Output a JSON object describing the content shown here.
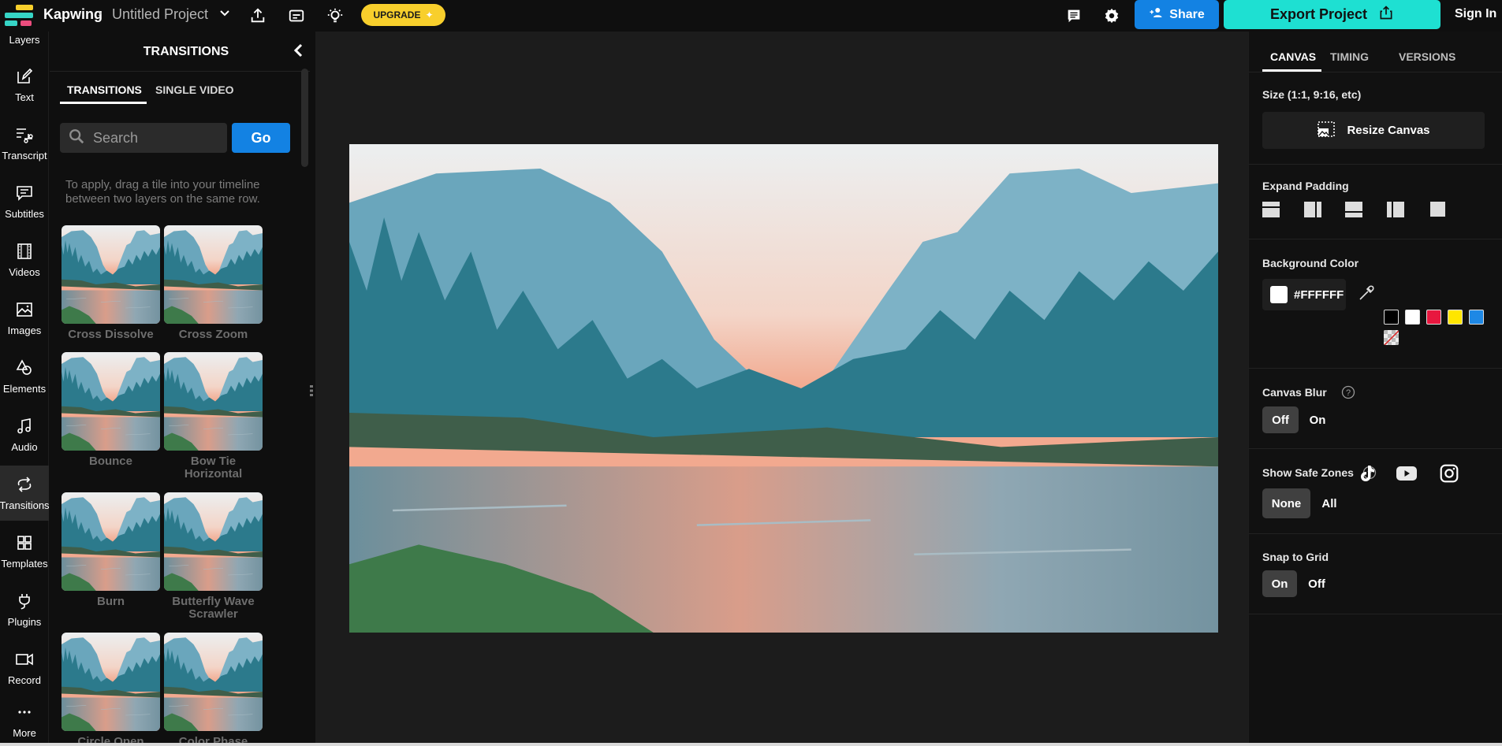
{
  "topbar": {
    "brand": "Kapwing",
    "separator": "›",
    "project_title": "Untitled Project",
    "icons": [
      "upload-icon",
      "subtitles-icon",
      "lightbulb-icon"
    ],
    "upgrade_label": "UPGRADE",
    "right_icons": [
      "comments-icon",
      "settings-gear-icon"
    ],
    "share_label": "Share",
    "export_label": "Export Project",
    "signin_label": "Sign In",
    "colors": {
      "upgrade": "#f8cf2c",
      "share": "#1382e3",
      "export": "#1ee0d2"
    }
  },
  "leftnav": {
    "items": [
      {
        "label": "Layers",
        "icon": "layers-icon"
      },
      {
        "label": "Text",
        "icon": "text-edit-icon"
      },
      {
        "label": "Transcript",
        "icon": "transcript-icon"
      },
      {
        "label": "Subtitles",
        "icon": "subtitles-icon"
      },
      {
        "label": "Videos",
        "icon": "film-icon"
      },
      {
        "label": "Images",
        "icon": "image-icon"
      },
      {
        "label": "Elements",
        "icon": "shapes-icon"
      },
      {
        "label": "Audio",
        "icon": "music-note-icon"
      },
      {
        "label": "Transitions",
        "icon": "transitions-icon",
        "active": true
      },
      {
        "label": "Templates",
        "icon": "grid-icon"
      },
      {
        "label": "Plugins",
        "icon": "plug-icon"
      },
      {
        "label": "Record",
        "icon": "camera-icon"
      },
      {
        "label": "More",
        "icon": "more-dots-icon"
      }
    ]
  },
  "panel": {
    "title": "TRANSITIONS",
    "tabs": [
      {
        "label": "TRANSITIONS",
        "active": true
      },
      {
        "label": "SINGLE VIDEO",
        "active": false
      }
    ],
    "search_placeholder": "Search",
    "search_value": "",
    "go_label": "Go",
    "hint": "To apply, drag a tile into your timeline between two layers on the same row.",
    "tiles": [
      {
        "label": "Cross Dissolve"
      },
      {
        "label": "Cross Zoom"
      },
      {
        "label": "Bounce"
      },
      {
        "label": "Bow Tie Horizontal"
      },
      {
        "label": "Burn"
      },
      {
        "label": "Butterfly Wave Scrawler"
      },
      {
        "label": "Circle Open"
      },
      {
        "label": "Color Phase"
      }
    ]
  },
  "right_panel": {
    "tabs": [
      {
        "label": "CANVAS",
        "active": true
      },
      {
        "label": "TIMING",
        "active": false
      },
      {
        "label": "VERSIONS",
        "active": false
      }
    ],
    "size_label": "Size (1:1, 9:16, etc)",
    "resize_label": "Resize Canvas",
    "expand_padding_label": "Expand Padding",
    "padding_options": [
      "pad-top-icon",
      "pad-right-icon",
      "pad-middle-icon",
      "pad-left-icon",
      "pad-none-icon"
    ],
    "background_color_label": "Background Color",
    "background_color_value": "#FFFFFF",
    "preset_colors": [
      "#000000",
      "#FFFFFF",
      "#E8173F",
      "#FFE600",
      "#1E88E5",
      "transparent"
    ],
    "canvas_blur_label": "Canvas Blur",
    "canvas_blur_options": [
      "Off",
      "On"
    ],
    "canvas_blur_selected": "Off",
    "safe_zones_label": "Show Safe Zones",
    "safe_zones_options": [
      "None",
      "All"
    ],
    "safe_zones_selected": "None",
    "safe_zones_platforms": [
      "tiktok-icon",
      "youtube-icon",
      "instagram-icon"
    ],
    "snap_label": "Snap to Grid",
    "snap_options": [
      "On",
      "Off"
    ],
    "snap_selected": "On"
  }
}
